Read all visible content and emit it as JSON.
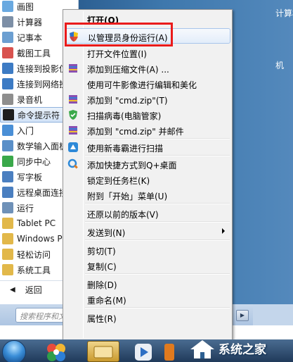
{
  "start_menu": {
    "programs": [
      {
        "label": "画图",
        "color": "#6aa9e0",
        "active": false
      },
      {
        "label": "计算器",
        "color": "#7d8fa6",
        "active": false
      },
      {
        "label": "记事本",
        "color": "#6c9fd1",
        "active": false
      },
      {
        "label": "截图工具",
        "color": "#d9534f",
        "active": false
      },
      {
        "label": "连接到投影仪",
        "color": "#3d7bc4",
        "active": false
      },
      {
        "label": "连接到网络投影仪",
        "color": "#3d7bc4",
        "active": false
      },
      {
        "label": "录音机",
        "color": "#8e8e8e",
        "active": false
      },
      {
        "label": "命令提示符",
        "color": "#1e1e1e",
        "active": true
      },
      {
        "label": "入门",
        "color": "#4a8fd6",
        "active": false
      },
      {
        "label": "数学输入面板",
        "color": "#5a8fc8",
        "active": false
      },
      {
        "label": "同步中心",
        "color": "#3aa84a",
        "active": false
      },
      {
        "label": "写字板",
        "color": "#4b7fc0",
        "active": false
      },
      {
        "label": "远程桌面连接",
        "color": "#4b7fc0",
        "active": false
      },
      {
        "label": "运行",
        "color": "#6f91b8",
        "active": false
      },
      {
        "label": "Tablet PC",
        "color": "#e2b84a",
        "active": false
      },
      {
        "label": "Windows PowerShell",
        "color": "#e2b84a",
        "active": false
      },
      {
        "label": "轻松访问",
        "color": "#e2b84a",
        "active": false
      },
      {
        "label": "系统工具",
        "color": "#e2b84a",
        "active": false
      }
    ],
    "back_arrow": "◀",
    "back_label": "返回",
    "search_placeholder": "搜索程序和文件",
    "shutdown_arrow": "▶",
    "right_items": [
      {
        "label": "计算机"
      },
      {
        "label": "机"
      }
    ]
  },
  "context_menu": {
    "items": [
      {
        "label": "打开(O)",
        "bold": true,
        "icon": null,
        "icon_name": "none"
      },
      {
        "label": "以管理员身份运行(A)",
        "hover": true,
        "icon": "#3b78c8",
        "icon_name": "uac-shield-icon"
      },
      {
        "label": "打开文件位置(I)",
        "icon": null,
        "icon_name": "none"
      },
      {
        "label": "添加到压缩文件(A) ...",
        "icon": "#7b4fa0",
        "icon_name": "winrar-icon"
      },
      {
        "label": "使用可牛影像进行编辑和美化",
        "icon": null,
        "icon_name": "none"
      },
      {
        "label": "添加到 \"cmd.zip\"(T)",
        "icon": "#7b4fa0",
        "icon_name": "winrar-icon"
      },
      {
        "label": "扫描病毒(电脑管家)",
        "icon": "#3aa84a",
        "icon_name": "pc-manager-shield-icon"
      },
      {
        "label": "添加到 \"cmd.zip\" 并邮件",
        "icon": "#7b4fa0",
        "icon_name": "winrar-icon"
      },
      {
        "label": "使用新毒霸进行扫描",
        "icon": "#2d89d8",
        "icon_name": "duba-icon"
      },
      {
        "label": "添加快捷方式到Q+桌面",
        "icon": "#e07a1e",
        "icon_name": "qplus-icon"
      },
      {
        "label": "锁定到任务栏(K)",
        "icon": null,
        "icon_name": "none"
      },
      {
        "label": "附到「开始」菜单(U)",
        "icon": null,
        "icon_name": "none"
      },
      {
        "label": "还原以前的版本(V)",
        "icon": null,
        "icon_name": "none"
      },
      {
        "label": "发送到(N)",
        "submenu": true,
        "icon": null,
        "icon_name": "none"
      },
      {
        "label": "剪切(T)",
        "icon": null,
        "icon_name": "none"
      },
      {
        "label": "复制(C)",
        "icon": null,
        "icon_name": "none"
      },
      {
        "label": "删除(D)",
        "icon": null,
        "icon_name": "none"
      },
      {
        "label": "重命名(M)",
        "icon": null,
        "icon_name": "none"
      },
      {
        "label": "属性(R)",
        "icon": null,
        "icon_name": "none"
      }
    ]
  },
  "watermark": {
    "text": "系统之家"
  },
  "colors": {
    "highlight_border": "#ea1b1b",
    "menu_hover": "#e3edfa",
    "start_right_bg": "#3e78ad",
    "taskbar_bg": "#2c4a6e"
  }
}
